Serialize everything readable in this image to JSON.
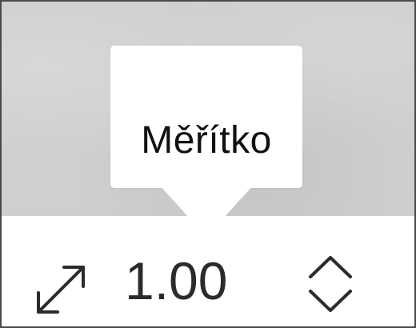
{
  "tooltip": {
    "label": "Měřítko"
  },
  "zoom_control": {
    "value": "1.00",
    "resize_icon": "diagonal-resize-icon",
    "increment_icon": "chevron-up-icon",
    "decrement_icon": "chevron-down-icon"
  },
  "colors": {
    "backdrop": "#cfcfcf",
    "tooltip_background": "#ffffff",
    "toolbar_background": "#ffffff",
    "text": "#2b2b2b",
    "frame_border": "#4a4a4a"
  }
}
